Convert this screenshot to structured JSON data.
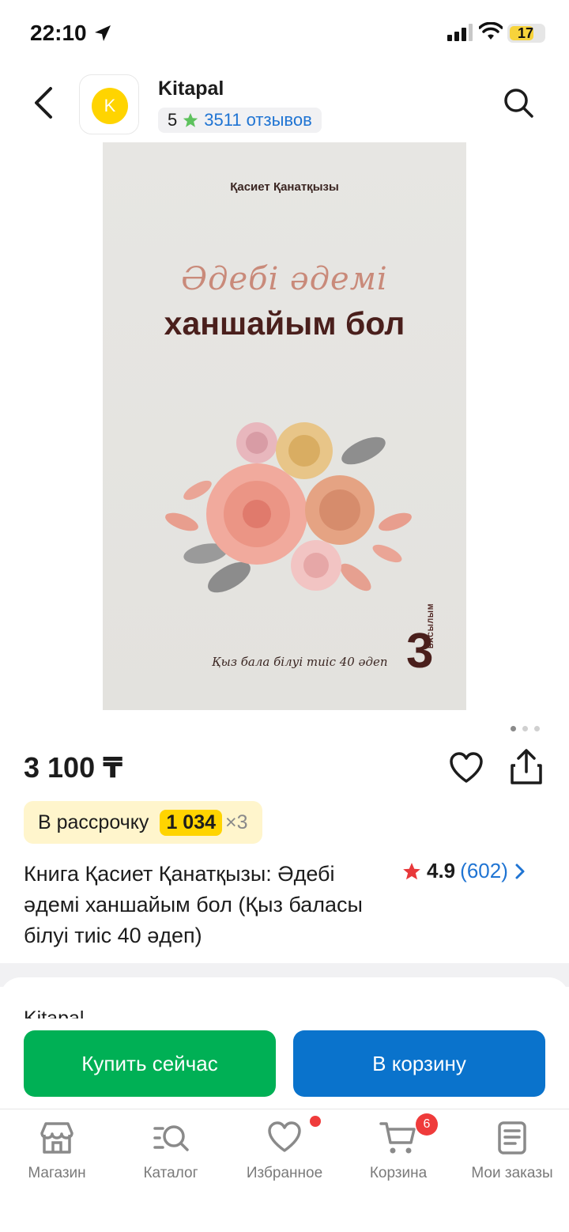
{
  "status": {
    "time": "22:10",
    "battery": "17"
  },
  "header": {
    "shop_name": "Kitapal",
    "logo_letter": "K",
    "shop_rating": "5",
    "reviews": "3511 отзывов"
  },
  "cover": {
    "author": "Қасиет Қанатқызы",
    "line1": "Әдебі әдемі",
    "line2": "ханшайым бол",
    "subtitle": "Қыз бала білуі тиіс 40 әдеп",
    "edition_num": "3",
    "edition_word": "БАСЫЛЫМ"
  },
  "product": {
    "price": "3 100 ₸",
    "installment_label": "В рассрочку",
    "installment_amount": "1 034",
    "installment_times": "×3",
    "title": "Книга Қасиет Қанатқызы: Әдебі әдемі ханшайым бол (Қыз баласы білуі тиіс 40 әдеп)",
    "rating": "4.9",
    "rating_count": "(602)"
  },
  "seller_section_title": "Kitapal",
  "actions": {
    "buy_now": "Купить сейчас",
    "add_to_cart": "В корзину"
  },
  "tabbar": {
    "items": [
      {
        "label": "Магазин",
        "icon": "store-icon"
      },
      {
        "label": "Каталог",
        "icon": "catalog-search-icon"
      },
      {
        "label": "Избранное",
        "icon": "heart-icon"
      },
      {
        "label": "Корзина",
        "icon": "cart-icon"
      },
      {
        "label": "Мои заказы",
        "icon": "orders-icon"
      }
    ],
    "cart_badge": "6"
  },
  "colors": {
    "accent_green": "#00b055",
    "accent_blue": "#0a73cc",
    "yellow": "#ffd400",
    "badge_red": "#ef3b3b"
  }
}
